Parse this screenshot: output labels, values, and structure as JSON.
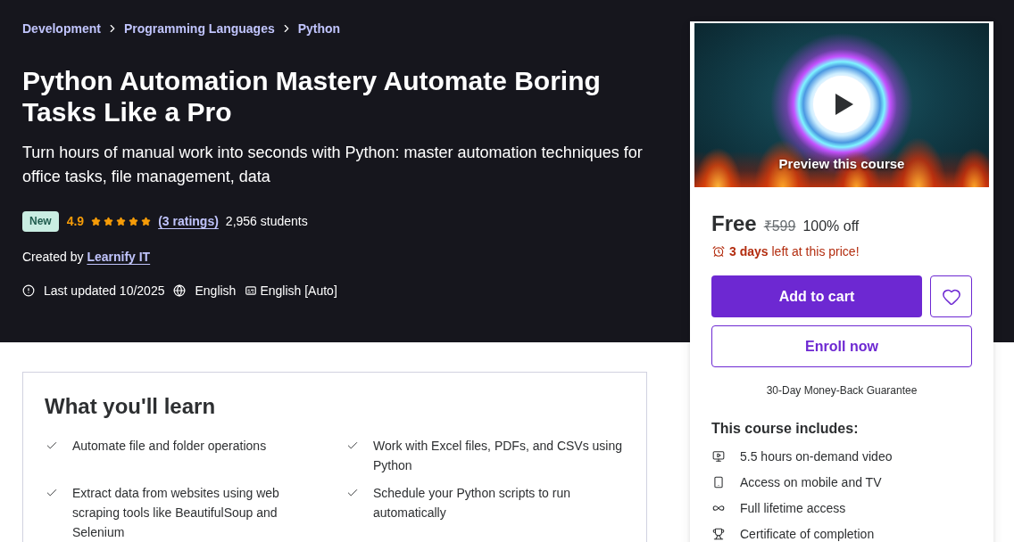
{
  "breadcrumb": [
    "Development",
    "Programming Languages",
    "Python"
  ],
  "course": {
    "title": "Python Automation Mastery Automate Boring Tasks Like a Pro",
    "subtitle": "Turn hours of manual work into seconds with Python: master automation techniques for office tasks, file management, data",
    "badge": "New",
    "rating": "4.9",
    "stars": 5,
    "ratings_link": "(3 ratings)",
    "students": "2,956 students",
    "created_by": "Created by",
    "instructor": "Learnify IT",
    "meta": [
      {
        "kind": "updated",
        "text": "Last updated 10/2025"
      },
      {
        "kind": "language",
        "text": "English"
      },
      {
        "kind": "captions",
        "text": "English [Auto]"
      }
    ]
  },
  "sidebar": {
    "preview_label": "Preview this course",
    "price": "Free",
    "original_price": "₹599",
    "discount": "100% off",
    "deadline": "**3 days** left at this price!",
    "buttons": [
      {
        "kind": "cart",
        "label": "Add to cart"
      },
      {
        "kind": "wishlist"
      },
      {
        "kind": "enroll",
        "label": "Enroll now"
      }
    ],
    "guarantee": "30-Day Money-Back Guarantee",
    "includes_title": "This course includes:",
    "includes": [
      {
        "kind": "video",
        "text": "5.5 hours on-demand video"
      },
      {
        "kind": "mobile",
        "text": "Access on mobile and TV"
      },
      {
        "kind": "lifetime",
        "text": "Full lifetime access"
      },
      {
        "kind": "certificate",
        "text": "Certificate of completion"
      }
    ]
  },
  "learn": {
    "title": "What you'll learn",
    "items": [
      "Automate file and folder operations",
      "Work with Excel files, PDFs, and CSVs using Python",
      "Extract data from websites using web scraping tools like BeautifulSoup and Selenium",
      "Schedule your Python scripts to run automatically"
    ]
  }
}
